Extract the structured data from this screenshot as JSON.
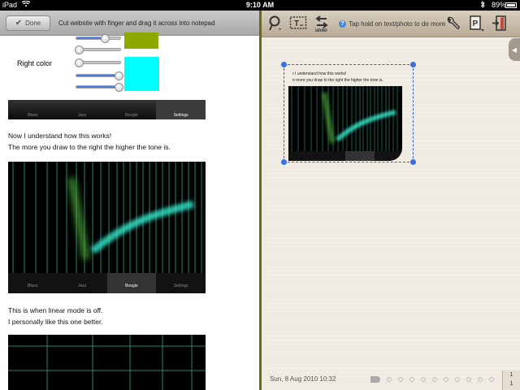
{
  "status_bar": {
    "carrier": "iPad",
    "time": "9:10 AM",
    "battery": "89%"
  },
  "left_toolbar": {
    "done_label": "Done",
    "hint": "Cut website with finger and drag it across into notepad"
  },
  "web": {
    "right_color_label": "Right color",
    "colors": {
      "left_swatch": "#8fa800",
      "right_swatch": "#00ffff"
    },
    "tabs_top": [
      "Blues",
      "Jazz",
      "Boogie",
      "Settings"
    ],
    "tabs_top_active": 3,
    "paragraph1_line1": "Now I understand how this works!",
    "paragraph1_line2": "The more you draw to the right the higher the tone is.",
    "tabs_viz": [
      "Blues",
      "Jazz",
      "Boogie",
      "Settings"
    ],
    "tabs_viz_active": 2,
    "paragraph2_line1": "This is when linear mode is off.",
    "paragraph2_line2": "I personally like this one better."
  },
  "right_toolbar": {
    "undo_label": "undo",
    "hint": "Tap hold on text/photo to do more"
  },
  "clip": {
    "line1": "r I understand how this works!",
    "line2": "e more you draw to the right the higher the tone is."
  },
  "notepad": {
    "date": "Sun, 8 Aug 2010 10:32",
    "page_top": "1",
    "page_bottom": "1"
  }
}
